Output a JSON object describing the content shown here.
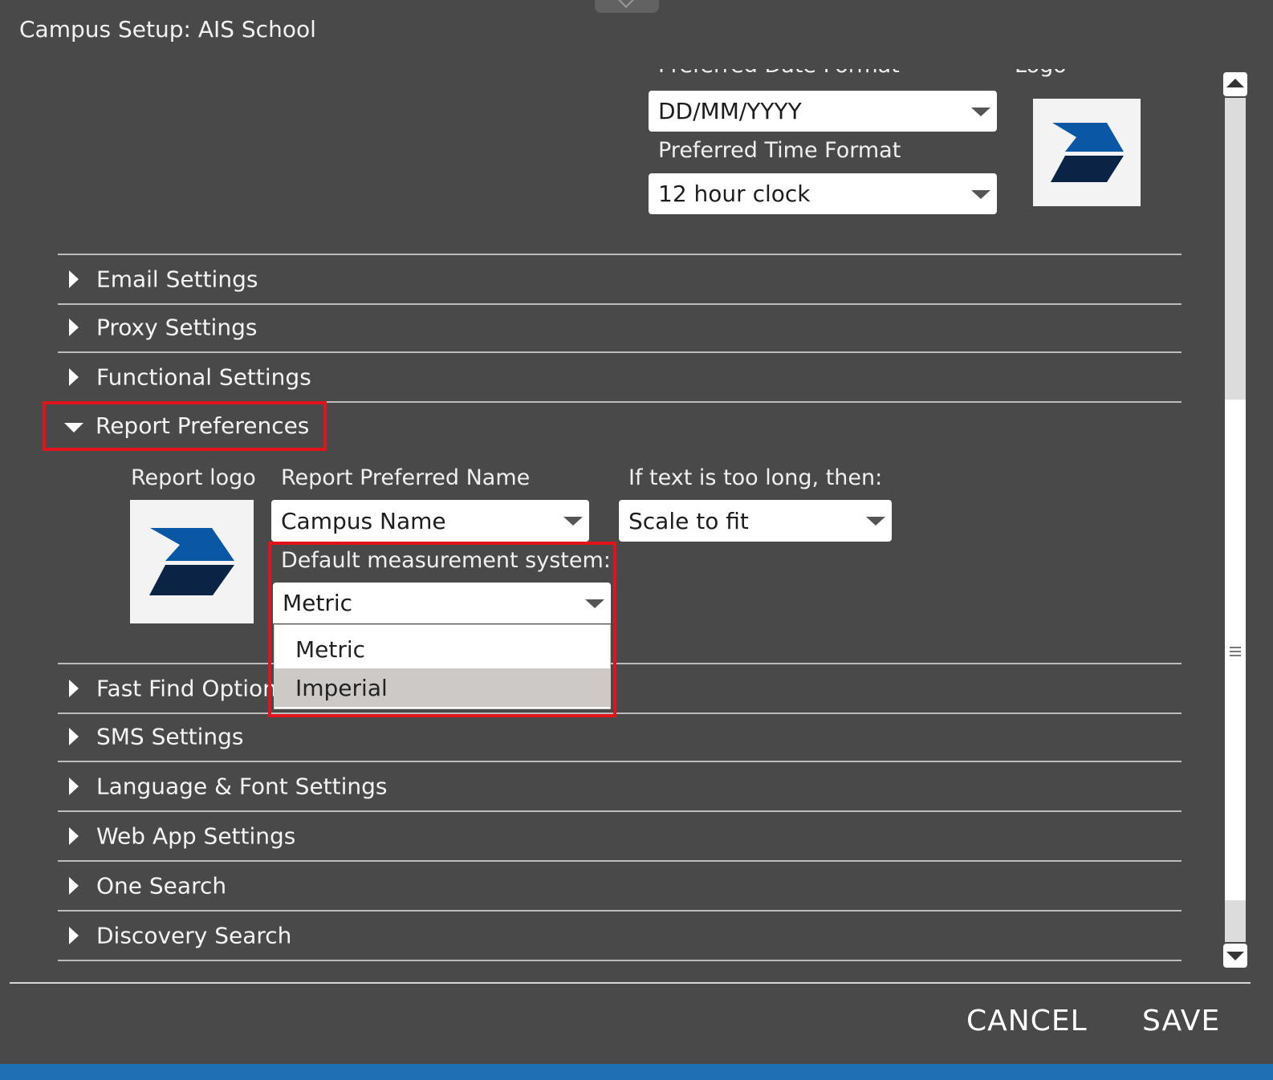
{
  "dialog": {
    "title": "Campus Setup: AIS School"
  },
  "general": {
    "date_format_label": "Preferred Date Format",
    "date_format_value": "DD/MM/YYYY",
    "time_format_label": "Preferred Time Format",
    "time_format_value": "12 hour clock",
    "logo_label": "Logo"
  },
  "sections_top": [
    {
      "label": "Email Settings"
    },
    {
      "label": "Proxy Settings"
    },
    {
      "label": "Functional Settings"
    }
  ],
  "report_preferences": {
    "label": "Report Preferences",
    "report_logo_label": "Report logo",
    "preferred_name_label": "Report Preferred Name",
    "preferred_name_value": "Campus Name",
    "overflow_label": "If text is too long, then:",
    "overflow_value": "Scale to fit",
    "measurement_label": "Default measurement system:",
    "measurement_value": "Metric",
    "measurement_options": [
      "Metric",
      "Imperial"
    ],
    "hovered_option": "Imperial"
  },
  "sections_bottom": [
    {
      "label": "Fast Find Options"
    },
    {
      "label": "SMS Settings"
    },
    {
      "label": "Language & Font Settings"
    },
    {
      "label": "Web App Settings"
    },
    {
      "label": "One Search"
    },
    {
      "label": "Discovery Search"
    }
  ],
  "footer": {
    "cancel_label": "CANCEL",
    "save_label": "SAVE"
  },
  "colors": {
    "background": "#4a494a",
    "highlight": "#e2141b",
    "logo_blue": "#0a57a5",
    "logo_navy": "#0b2446",
    "accent_strip": "#1f6fb5"
  },
  "icons": {
    "logo": "chevron-logo-icon",
    "collapsed": "caret-right-icon",
    "expanded": "caret-down-icon",
    "dropdown": "caret-down-icon"
  }
}
